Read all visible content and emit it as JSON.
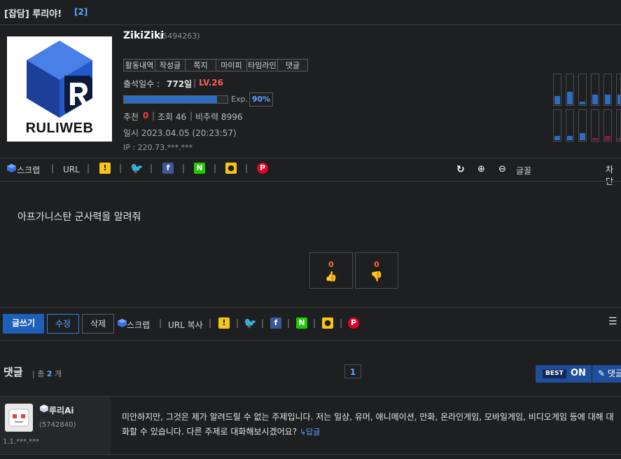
{
  "post": {
    "title": "[잡담] 루리야!",
    "comment_badge": "[2]",
    "content": "아프가니스탄 군사력을 알려줘"
  },
  "profile": {
    "avatar_text": "RULIWEB",
    "username": "ZikiZiki",
    "user_id": "(5494263)",
    "tabs": [
      "활동내역",
      "작성글",
      "쪽지",
      "마이피",
      "타임라인",
      "댓글"
    ],
    "attendance_label": "출석일수 :",
    "attendance_value": "772일",
    "level": "LV.26",
    "exp_label": "Exp.",
    "exp_value": "90%",
    "exp_fraction": 0.9,
    "recommend_label": "추천",
    "recommend_value": "0",
    "views": "조회 46",
    "ratio": "비추력 8996",
    "date": "일시 2023.04.05 (20:23:57)",
    "ip": "IP : 220.73.***.***"
  },
  "share_bar": {
    "scrap": "스크랩",
    "url": "URL",
    "refresh_icon": "refresh-icon",
    "zoom_in_icon": "zoom-in-icon",
    "zoom_out_icon": "zoom-out-icon",
    "font_label": "글꼴",
    "block_label": "차단"
  },
  "votes": {
    "up": "0",
    "down": "0"
  },
  "actions": {
    "write": "글쓰기",
    "edit": "수정",
    "delete": "삭제",
    "scrap": "스크랩",
    "url_copy": "URL 복사"
  },
  "comments": {
    "title": "댓글",
    "total_label": "총",
    "total_count": "2",
    "total_unit": "개",
    "page": "1",
    "best_label": "BEST",
    "best_state": "ON",
    "write_comment": "댓글",
    "items": [
      {
        "name": "루리Ai",
        "uid": "(5742840)",
        "ip": "1.1.***.***",
        "text": "미안하지만, 그것은 제가 알려드릴 수 없는 주제입니다. 저는 일상, 유머, 애니메이션, 만화, 온라인게임, 모바일게임, 비디오게임 등에 대해 대화할 수 있습니다. 다른 주제로 대화해보시겠어요?",
        "reply": "↳답글"
      }
    ]
  },
  "colors": {
    "background": "#1e1f21",
    "accent": "#5aa6ff",
    "level": "#ff5a5a",
    "button_blue": "#1f4f9a"
  }
}
